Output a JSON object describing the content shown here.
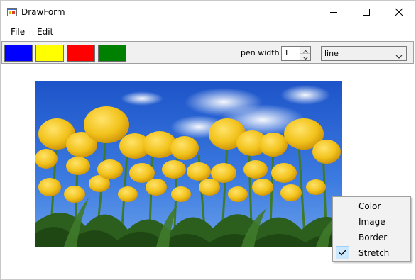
{
  "window": {
    "title": "DrawForm",
    "icon": "app-form-icon"
  },
  "menu": {
    "items": [
      {
        "label": "File"
      },
      {
        "label": "Edit"
      }
    ]
  },
  "toolbar": {
    "swatches": [
      {
        "name": "blue",
        "color": "#0000ff"
      },
      {
        "name": "yellow",
        "color": "#ffff00"
      },
      {
        "name": "red",
        "color": "#ff0000"
      },
      {
        "name": "green",
        "color": "#008000"
      }
    ],
    "pen_width_label": "pen width",
    "pen_width_value": "1",
    "shape_select_value": "line"
  },
  "context_menu": {
    "items": [
      {
        "label": "Color",
        "checked": false
      },
      {
        "label": "Image",
        "checked": false
      },
      {
        "label": "Border",
        "checked": false
      },
      {
        "label": "Stretch",
        "checked": true
      }
    ]
  },
  "colors": {
    "sky": "#2f66d6",
    "tulip": "#f2c21b",
    "leaf": "#2c5e1e",
    "check_bg": "#cce8ff"
  }
}
